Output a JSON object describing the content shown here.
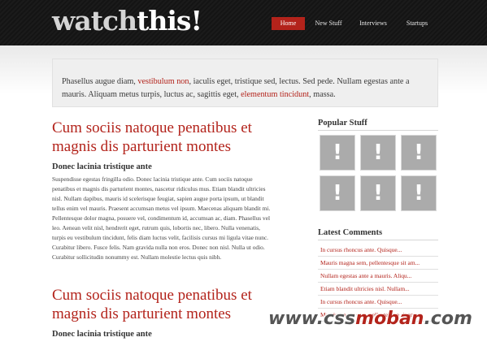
{
  "header": {
    "logo_part1": "watch",
    "logo_part2": "this!",
    "nav": [
      "Home",
      "New Stuff",
      "Interviews",
      "Startups"
    ]
  },
  "intro": {
    "t1": "Phasellus augue diam, ",
    "l1": "vestibulum non",
    "t2": ", iaculis eget, tristique sed, lectus. Sed pede. Nullam egestas ante a mauris. Aliquam metus turpis, luctus ac, sagittis eget, ",
    "l2": "elementum tincidunt",
    "t3": ", massa."
  },
  "posts": [
    {
      "title": "Cum sociis natoque penatibus et magnis dis parturient montes",
      "subtitle": "Donec lacinia tristique ante",
      "body": "Suspendisse egestas fringilla odio. Donec lacinia tristique ante. Cum sociis natoque penatibus et magnis dis parturient montes, nascetur ridiculus mus. Etiam blandit ultricies nisl. Nullam dapibus, mauris id scelerisque feugiat, sapien augue porta ipsum, ut blandit tellus enim vel mauris. Praesent accumsan metus vel ipsum. Maecenas aliquam blandit mi. Pellentesque dolor magna, posuere vel, condimentum id, accumsan ac, diam. Phasellus vel leo. Aenean velit nisl, hendrerit eget, rutrum quis, lobortis nec, libero. Nulla venenatis, turpis eu vestibulum tincidunt, felis diam luctus velit, facilisis cursus mi ligula vitae nunc. Curabitur libero. Fusce felis. Nam gravida nulla non eros. Donec non nisl. Nulla ut odio. Curabitur sollicitudin nonummy est. Nullam molestie lectus quis nibh."
    },
    {
      "title": "Cum sociis natoque penatibus et magnis dis parturient montes",
      "subtitle": "Donec lacinia tristique ante"
    }
  ],
  "sidebar": {
    "popular_heading": "Popular Stuff",
    "thumb_glyph": "!",
    "latest_heading": "Latest Comments",
    "comments": [
      "In cursus rhoncus ante. Quisque...",
      "Mauris magna sem, pellentesque sit am...",
      "Nullam egestas ante a mauris. Aliqu...",
      "Etiam blandit ultricies nisl. Nullam...",
      "In cursus rhoncus ante. Quisque...",
      "Mauris magna sem, pellentesque sit am..."
    ]
  },
  "watermark": {
    "part1": "www.css",
    "part2": "moban",
    "part3": ".com"
  },
  "colors": {
    "accent": "#b3231b",
    "header_bg": "#141414"
  }
}
